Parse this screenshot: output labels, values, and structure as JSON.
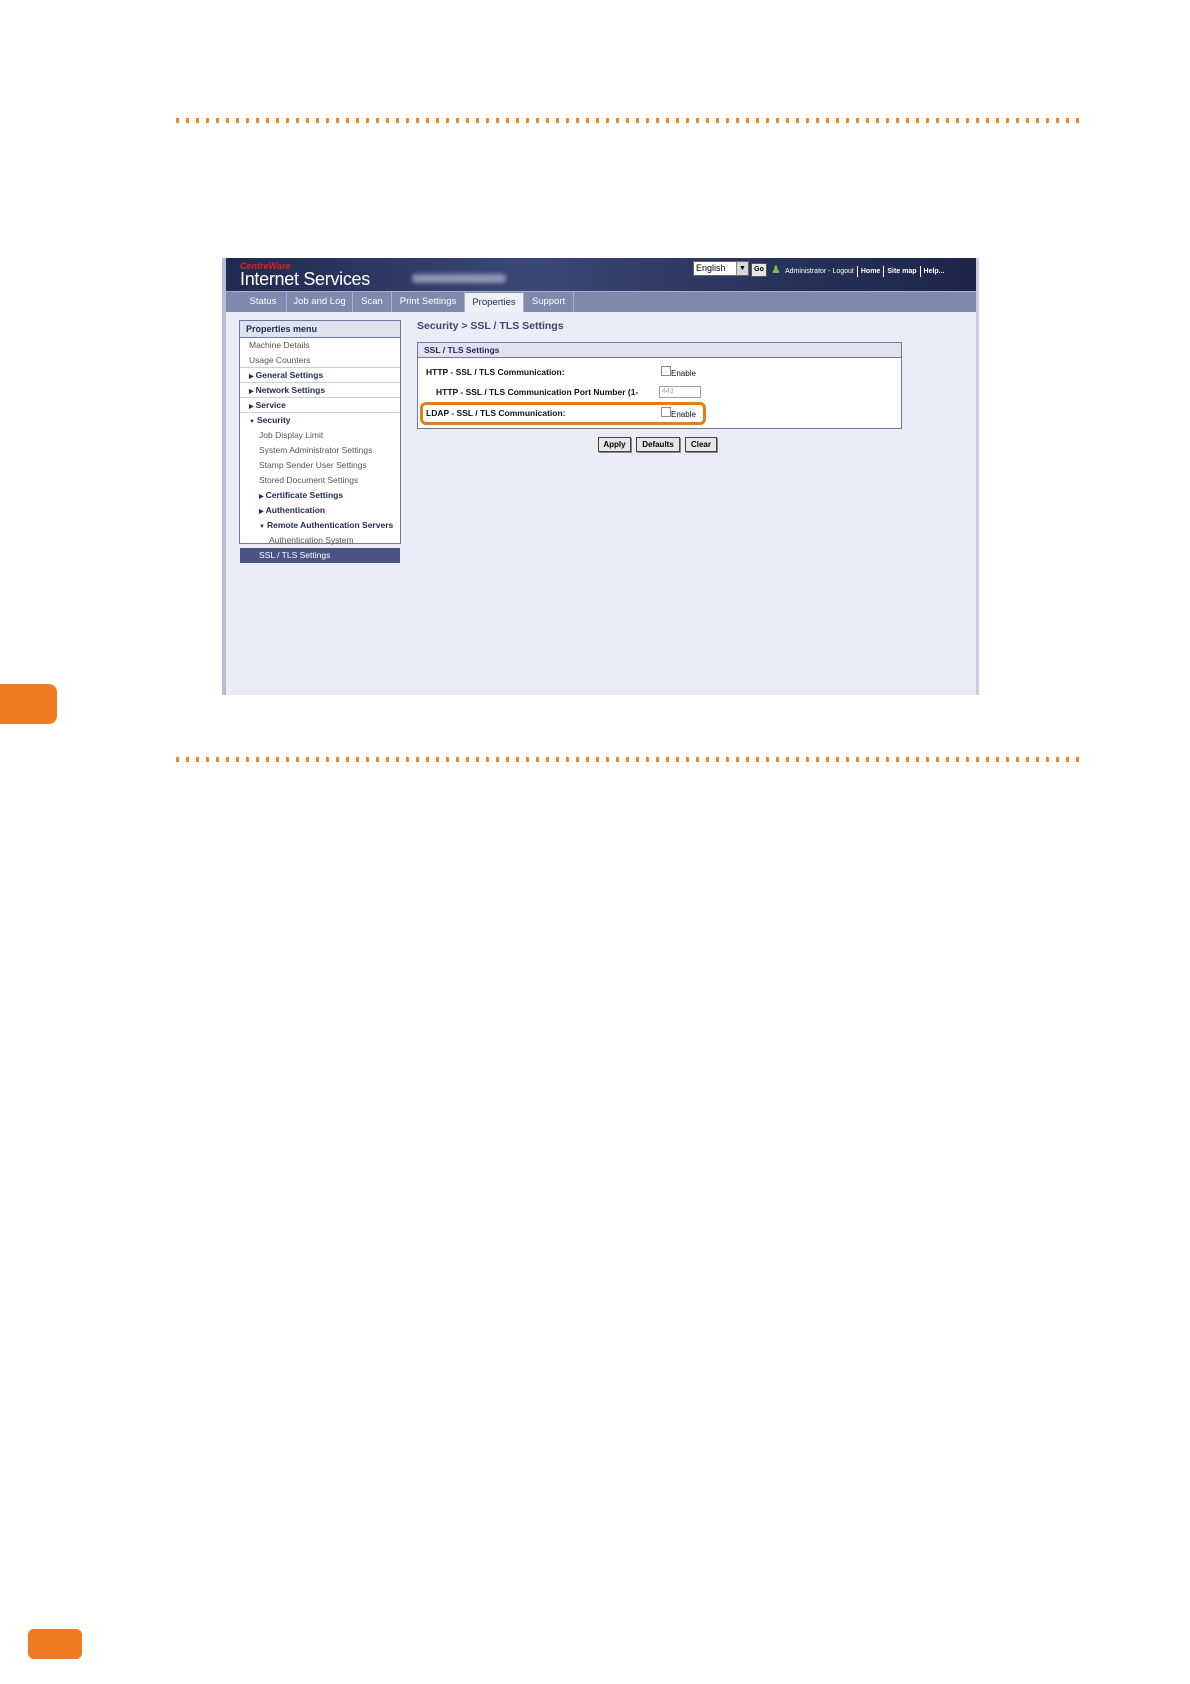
{
  "header": {
    "brand_small": "CentreWare",
    "brand_title": "Internet Services",
    "language_selected": "English",
    "go_label": "Go",
    "links": [
      "Administrator - Logout",
      "Home",
      "Site map",
      "Help..."
    ]
  },
  "tabs": [
    {
      "label": "Status",
      "active": false
    },
    {
      "label": "Job and Log",
      "active": false
    },
    {
      "label": "Scan",
      "active": false
    },
    {
      "label": "Print Settings",
      "active": false
    },
    {
      "label": "Properties",
      "active": true
    },
    {
      "label": "Support",
      "active": false
    }
  ],
  "menu": {
    "title": "Properties menu",
    "items": [
      {
        "label": "Machine Details"
      },
      {
        "label": "Usage Counters"
      },
      {
        "label": "General Settings",
        "prefix": "▸"
      },
      {
        "label": "Network Settings",
        "prefix": "▸"
      },
      {
        "label": "Service",
        "prefix": "▸"
      },
      {
        "label": "Security",
        "prefix": "▾"
      },
      {
        "label": "Job Display Limit"
      },
      {
        "label": "System Administrator Settings"
      },
      {
        "label": "Stamp Sender User Settings"
      },
      {
        "label": "Stored Document Settings"
      },
      {
        "label": "Certificate Settings",
        "prefix": "▸"
      },
      {
        "label": "Authentication",
        "prefix": "▸"
      },
      {
        "label": "Remote Authentication Servers",
        "prefix": "▾"
      },
      {
        "label": "Authentication System"
      },
      {
        "label": "SSL / TLS Settings",
        "selected": true
      }
    ]
  },
  "main": {
    "breadcrumb": "Security > SSL / TLS Settings",
    "panel_title": "SSL / TLS Settings",
    "http_label": "HTTP - SSL / TLS Communication:",
    "http_enable": "Enable",
    "port_label": "HTTP - SSL / TLS Communication Port Number (1-",
    "port_value": "443",
    "ldap_label": "LDAP - SSL / TLS Communication:",
    "ldap_enable": "Enable",
    "buttons": {
      "apply": "Apply",
      "defaults": "Defaults",
      "clear": "Clear"
    }
  },
  "colors": {
    "accent": "#f07a22",
    "highlight": "#e57c1a",
    "header_bg": "#2a355e",
    "selected_item": "#4a5585"
  }
}
